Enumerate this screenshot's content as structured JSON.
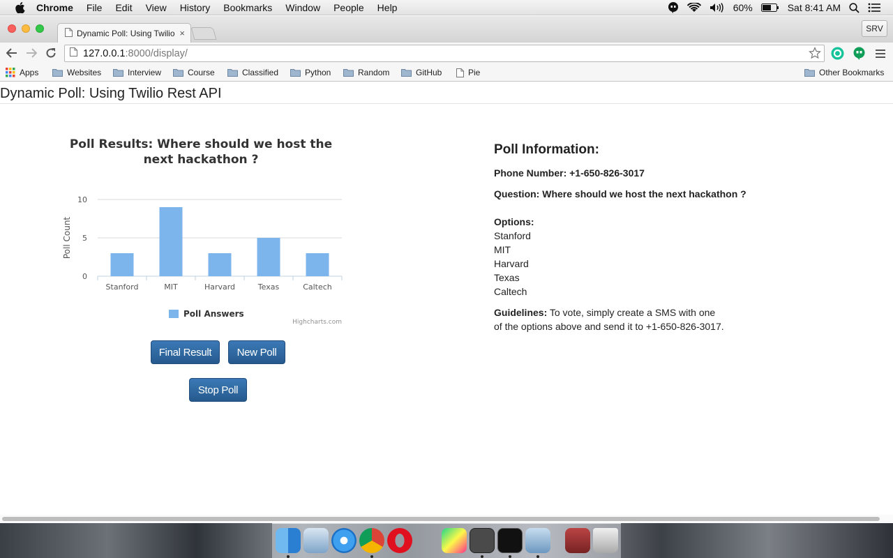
{
  "menubar": {
    "app_name": "Chrome",
    "items": [
      "File",
      "Edit",
      "View",
      "History",
      "Bookmarks",
      "Window",
      "People",
      "Help"
    ],
    "battery": "60%",
    "clock": "Sat 8:41 AM"
  },
  "tab": {
    "title": "Dynamic Poll: Using Twilio",
    "close": "×"
  },
  "profile": "SRV",
  "url": {
    "host": "127.0.0.1",
    "path": ":8000/display/"
  },
  "bookmarks": [
    {
      "label": "Apps",
      "icon": "apps-grid-icon"
    },
    {
      "label": "Websites",
      "icon": "folder-icon"
    },
    {
      "label": "Interview",
      "icon": "folder-icon"
    },
    {
      "label": "Course",
      "icon": "folder-icon"
    },
    {
      "label": "Classified",
      "icon": "folder-icon"
    },
    {
      "label": "Python",
      "icon": "folder-icon"
    },
    {
      "label": "Random",
      "icon": "folder-icon"
    },
    {
      "label": "GitHub",
      "icon": "folder-icon"
    },
    {
      "label": "Pie",
      "icon": "page-icon"
    }
  ],
  "other_bookmarks": "Other Bookmarks",
  "page": {
    "title": "Dynamic Poll: Using Twilio Rest API"
  },
  "chart_data": {
    "type": "bar",
    "title": "Poll Results: Where should we host the next hackathon ?",
    "categories": [
      "Stanford",
      "MIT",
      "Harvard",
      "Texas",
      "Caltech"
    ],
    "series": [
      {
        "name": "Poll Answers",
        "values": [
          3,
          9,
          3,
          5,
          3
        ]
      }
    ],
    "ylabel": "Poll Count",
    "ylim": [
      0,
      10
    ],
    "yticks": [
      0,
      5,
      10
    ],
    "grid": true,
    "legend": "bottom-center",
    "credits": "Highcharts.com",
    "color": "#7cb5ec"
  },
  "buttons": {
    "final": "Final Result",
    "new": "New Poll",
    "stop": "Stop Poll"
  },
  "info": {
    "heading": "Poll Information:",
    "phone_label": "Phone Number:",
    "phone": "+1-650-826-3017",
    "question_label": "Question:",
    "question": "Where should we host the next hackathon ?",
    "options_label": "Options:",
    "options": [
      "Stanford",
      "MIT",
      "Harvard",
      "Texas",
      "Caltech"
    ],
    "guidelines_label": "Guidelines:",
    "guidelines_line1": "To vote, simply create a SMS with one",
    "guidelines_line2": "of the options above and send it to +1-650-826-3017."
  },
  "dock_apps": [
    "finder-icon",
    "mail-icon",
    "safari-icon",
    "chrome-icon",
    "opera-icon",
    "pycharm-icon",
    "sublime-text-icon",
    "terminal-icon",
    "preview-icon",
    "photo-booth-icon",
    "trash-icon"
  ]
}
